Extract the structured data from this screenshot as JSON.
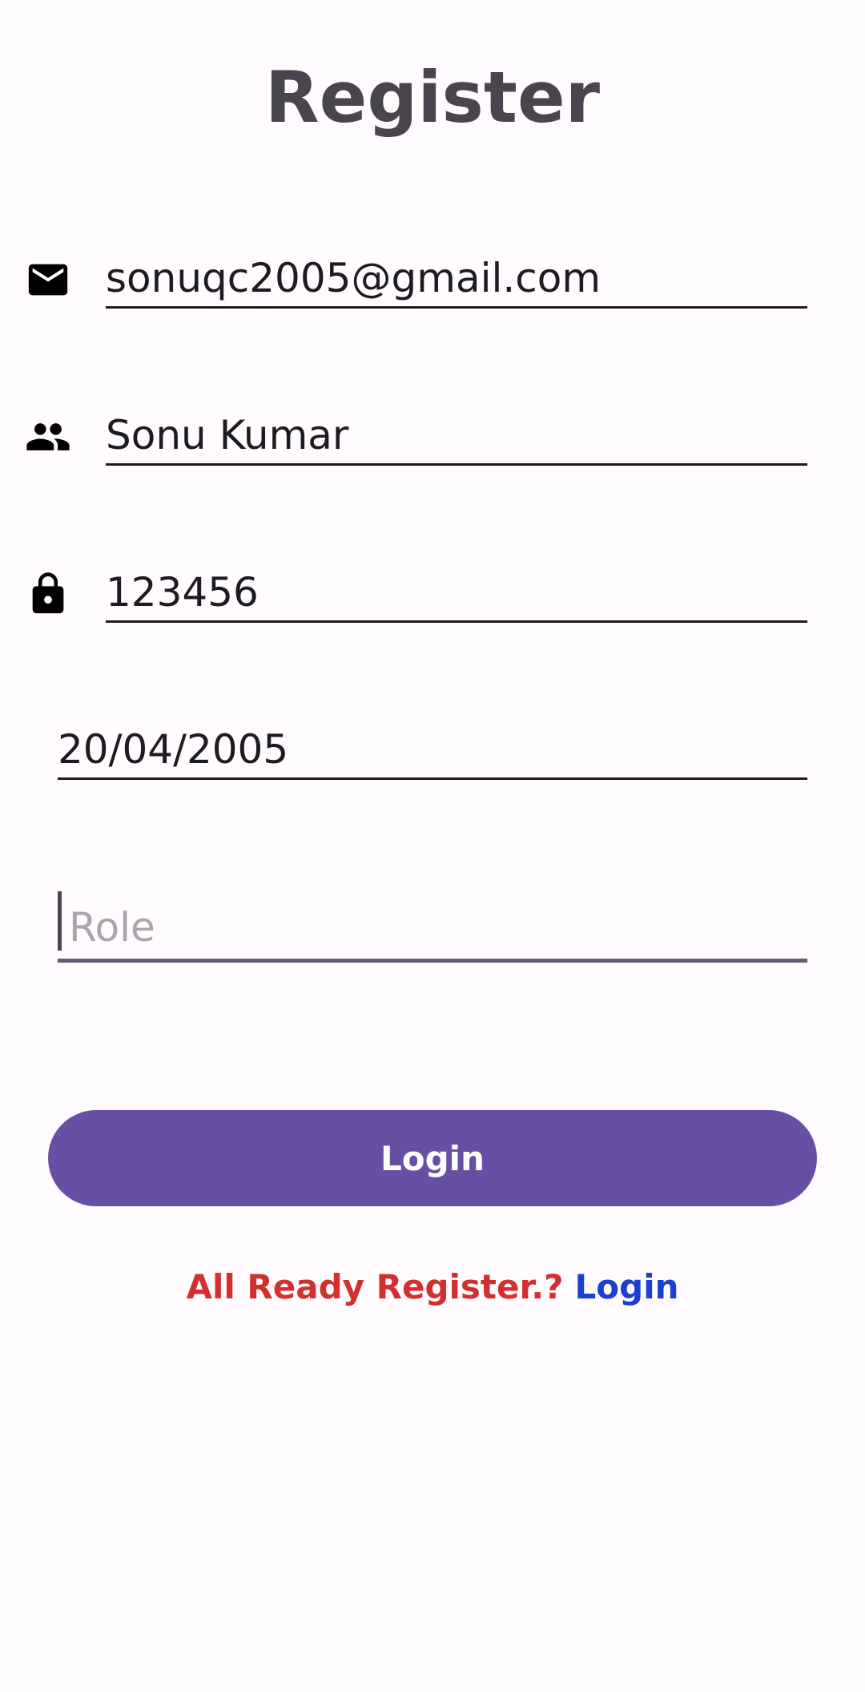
{
  "page": {
    "title": "Register"
  },
  "form": {
    "email": {
      "value": "sonuqc2005@gmail.com",
      "icon": "email-icon"
    },
    "name": {
      "value": "Sonu Kumar",
      "icon": "people-icon"
    },
    "password": {
      "value": "123456",
      "icon": "lock-icon"
    },
    "dob": {
      "value": "20/04/2005"
    },
    "role": {
      "value": "",
      "placeholder": "Role"
    },
    "submit_label": "Login"
  },
  "footer": {
    "prompt": "All Ready Register.?",
    "link_label": "Login"
  },
  "colors": {
    "background": "#fffbfe",
    "title": "#49454f",
    "button": "#6750a4",
    "prompt": "#d32f2f",
    "link": "#1a3fd1"
  }
}
